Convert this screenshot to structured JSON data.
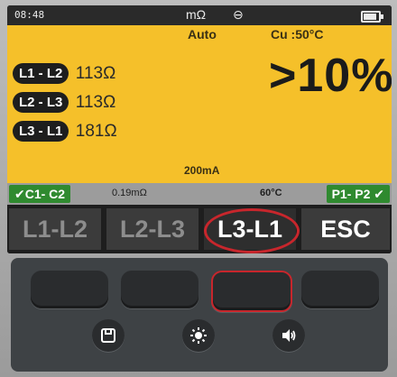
{
  "status": {
    "time": "08:48",
    "unit": "mΩ",
    "phase_symbol": "⊖",
    "battery_level": 0.85
  },
  "header": {
    "mode": "Auto",
    "material": "Cu :50°C"
  },
  "result": {
    "value": ">10%"
  },
  "readings": [
    {
      "pair": "L1 - L2",
      "value": "113Ω"
    },
    {
      "pair": "L2 - L3",
      "value": "113Ω"
    },
    {
      "pair": "L3 - L1",
      "value": "181Ω"
    }
  ],
  "test_current": "200mA",
  "info_strip": {
    "left_check": "✔C1- C2",
    "resistance": "0.19mΩ",
    "temperature": "60°C",
    "right_check": "P1- P2 ✔"
  },
  "softkeys": [
    "L1-L2",
    "L2-L3",
    "L3-L1",
    "ESC"
  ],
  "colors": {
    "screen_bg": "#f5c02a",
    "ok_green": "#2f8a2f",
    "highlight_red": "#c8262c"
  },
  "hardware_icons": [
    "save-icon",
    "brightness-icon",
    "speaker-icon"
  ]
}
